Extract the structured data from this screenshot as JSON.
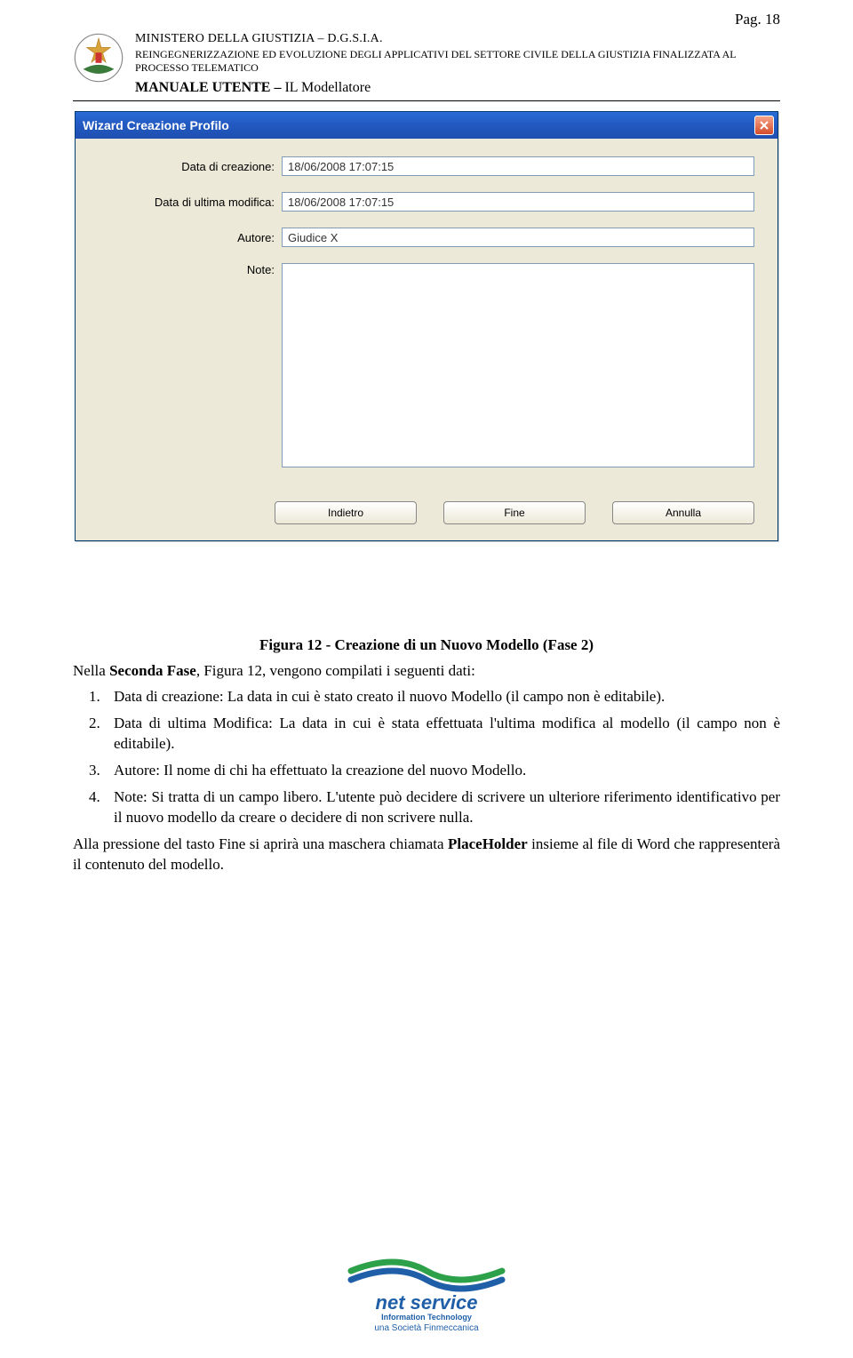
{
  "page_number": "Pag. 18",
  "header": {
    "line1": "MINISTERO DELLA GIUSTIZIA – D.G.S.I.A.",
    "line2": "REINGEGNERIZZAZIONE ED EVOLUZIONE DEGLI APPLICATIVI DEL SETTORE CIVILE DELLA GIUSTIZIA FINALIZZATA AL PROCESSO TELEMATICO",
    "line3_prefix": "MANUALE UTENTE – ",
    "line3_suffix": "IL Modellatore"
  },
  "dialog": {
    "title": "Wizard Creazione Profilo",
    "fields": {
      "data_creazione_label": "Data di creazione:",
      "data_creazione_value": "18/06/2008 17:07:15",
      "data_modifica_label": "Data di ultima modifica:",
      "data_modifica_value": "18/06/2008 17:07:15",
      "autore_label": "Autore:",
      "autore_value": "Giudice X",
      "note_label": "Note:",
      "note_value": ""
    },
    "buttons": {
      "indietro": "Indietro",
      "fine": "Fine",
      "annulla": "Annulla"
    }
  },
  "caption": "Figura 12 - Creazione di un Nuovo Modello (Fase 2)",
  "body": {
    "intro_prefix": "Nella ",
    "intro_bold": "Seconda Fase",
    "intro_suffix": ", Figura 12, vengono compilati i seguenti dati:",
    "items": [
      "Data di creazione: La data in cui è stato creato il nuovo Modello (il campo non è editabile).",
      "Data di ultima Modifica: La data in cui è stata effettuata l'ultima modifica al modello (il campo non è editabile).",
      "Autore: Il nome di chi ha effettuato la creazione del nuovo Modello.",
      "Note: Si tratta di un campo libero. L'utente può decidere di scrivere un ulteriore riferimento identificativo per il nuovo modello da creare o decidere di non scrivere nulla."
    ],
    "final_prefix": "Alla pressione del tasto Fine si aprirà una maschera chiamata ",
    "final_bold": "PlaceHolder",
    "final_suffix": " insieme al file di Word che rappresenterà il contenuto del modello."
  },
  "footer": {
    "brand_main": "net service",
    "brand_sub": "Information Technology",
    "brand_tag": "una Società Finmeccanica"
  }
}
